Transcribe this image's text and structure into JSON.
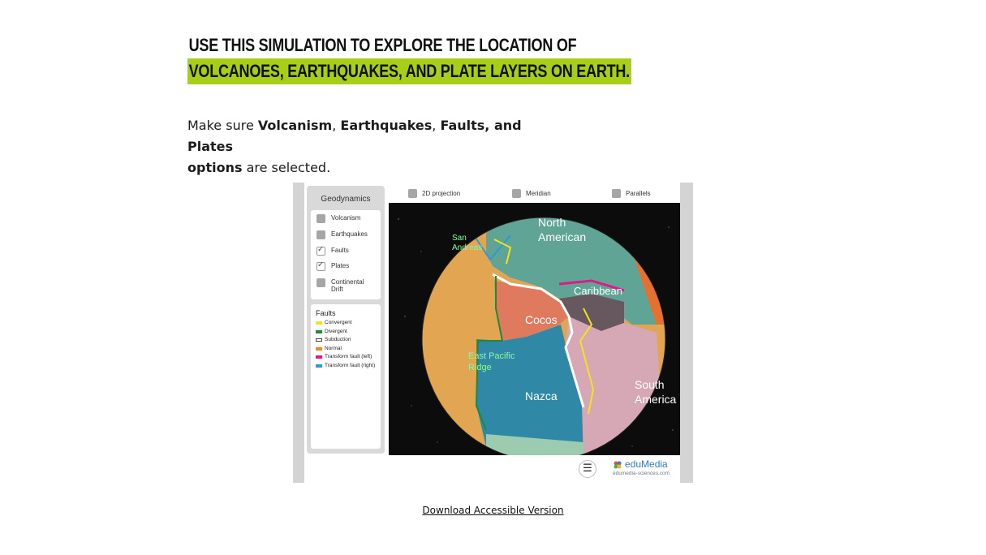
{
  "heading": {
    "line1": "Use this simulation to explore the location of",
    "line2": "volcanoes, earthquakes, and plate layers on Earth."
  },
  "instructions": {
    "make_sure": "Make sure ",
    "volcanism": "Volcanism",
    "comma1": ", ",
    "earthquakes": "Earthquakes",
    "comma2": ", ",
    "faults_plates": "Faults, and Plates",
    "options": "options",
    "selected": " are selected."
  },
  "sim": {
    "sidebar_title": "Geodynamics",
    "options": [
      {
        "label": "Volcanism",
        "checked": false
      },
      {
        "label": "Earthquakes",
        "checked": false
      },
      {
        "label": "Faults",
        "checked": true
      },
      {
        "label": "Plates",
        "checked": true
      },
      {
        "label": "Continental Drift",
        "checked": false
      }
    ],
    "legend": {
      "title": "Faults",
      "items": [
        {
          "label": "Convergent",
          "color": "#f4e21a"
        },
        {
          "label": "Divergent",
          "color": "#1e8a3a"
        },
        {
          "label": "Subduction",
          "color": "#ffffff"
        },
        {
          "label": "Normal",
          "color": "#f08a1c"
        },
        {
          "label": "Transform fault (left)",
          "color": "#e0198a"
        },
        {
          "label": "Transform fault (right)",
          "color": "#2a9ad8"
        }
      ]
    },
    "topbar": {
      "projection": "2D projection",
      "meridian": "Meridian",
      "parallels": "Parallels"
    },
    "globe_labels": {
      "north_american": "North\nAmerican",
      "san_andreas": "San\nAndreas",
      "caribbean": "Caribbean",
      "cocos": "Cocos",
      "east_pacific_ridge": "East Pacific\nRidge",
      "nazca": "Nazca",
      "south_america": "South\nAmerica"
    },
    "menu_icon": "hamburger-menu-icon",
    "brand": "eduMedia",
    "brand_url": "edumedia-sciences.com"
  },
  "download_link": "Download Accessible Version"
}
